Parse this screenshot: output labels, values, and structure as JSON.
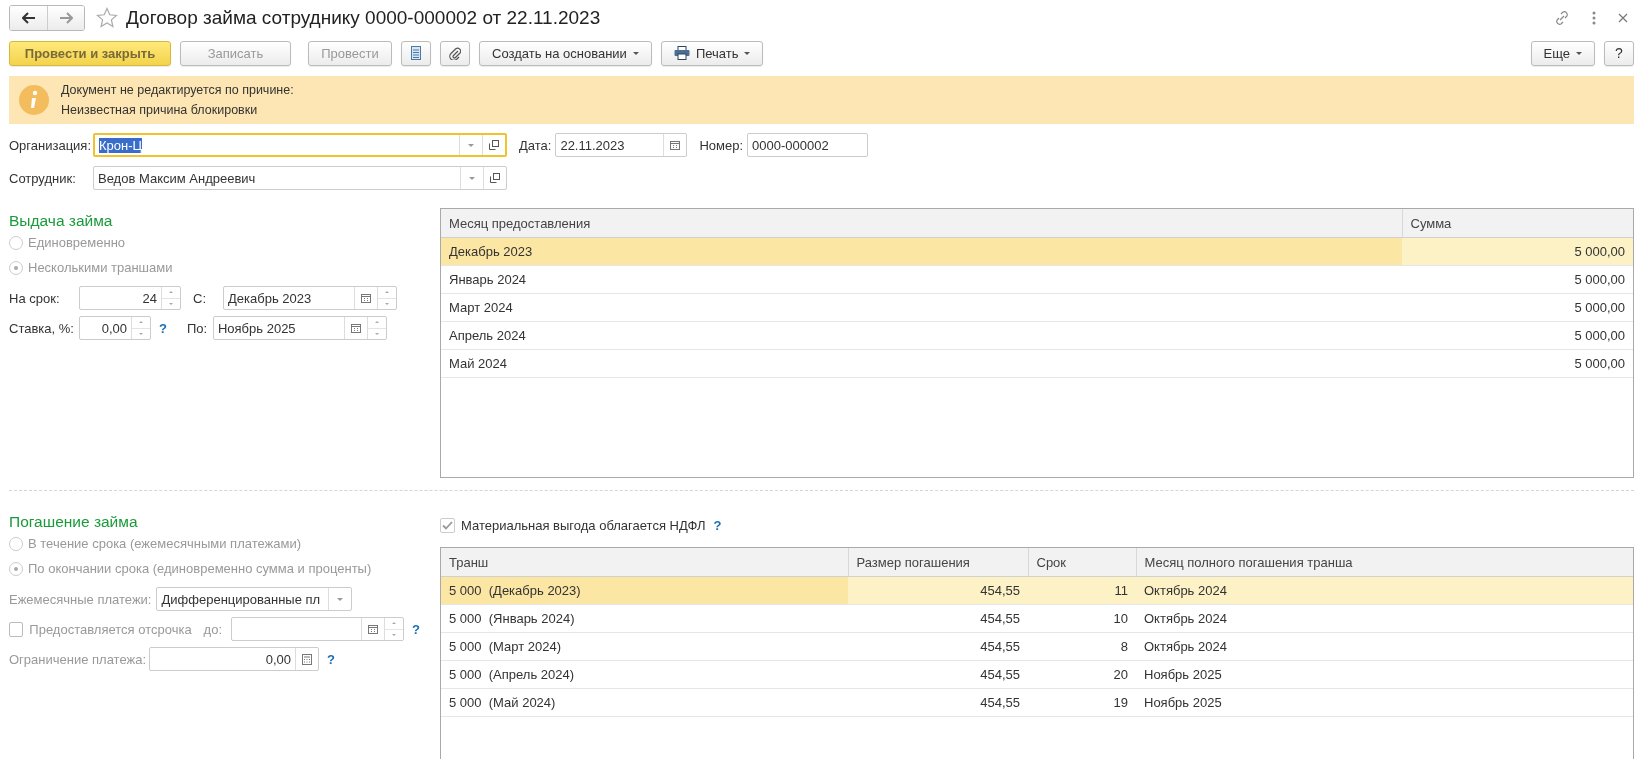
{
  "window": {
    "title": "Договор займа сотруднику 0000-000002 от 22.11.2023"
  },
  "toolbar": {
    "primary": "Провести и закрыть",
    "buttons": [
      {
        "label": "Записать",
        "disabled": true
      },
      {
        "label": "Провести",
        "disabled": true
      }
    ],
    "menus": [
      {
        "label": "Создать на основании",
        "kind": "plain"
      },
      {
        "label": "Печать",
        "kind": "print"
      }
    ],
    "more": "Еще",
    "help": "?"
  },
  "banner": {
    "lines": [
      "Документ не редактируется по причине:",
      "Неизвестная причина блокировки"
    ]
  },
  "organization": {
    "label": "Организация:",
    "value": "Крон-Ц",
    "focused": true
  },
  "date": {
    "label": "Дата:",
    "value": "22.11.2023"
  },
  "number": {
    "label": "Номер:",
    "value": "0000-000002"
  },
  "employee": {
    "label": "Сотрудник:",
    "value": "Ведов Максим Андреевич"
  },
  "issue": {
    "title": "Выдача займа",
    "options": [
      {
        "label": "Единовременно",
        "selected": false
      },
      {
        "label": "Несколькими траншами",
        "selected": true
      }
    ],
    "term": {
      "label": "На срок:",
      "value": "24"
    },
    "from": {
      "label": "С:",
      "value": "Декабрь 2023"
    },
    "rate": {
      "label": "Ставка, %:",
      "value": "0,00",
      "help": "?"
    },
    "to": {
      "label": "По:",
      "value": "Ноябрь 2025"
    },
    "table": {
      "columns": [
        "Месяц предоставления",
        "Сумма"
      ],
      "rows": [
        {
          "cells": [
            "Декабрь 2023",
            "5 000,00"
          ],
          "selected": true
        },
        {
          "cells": [
            "Январь 2024",
            "5 000,00"
          ],
          "selected": false
        },
        {
          "cells": [
            "Март 2024",
            "5 000,00"
          ],
          "selected": false
        },
        {
          "cells": [
            "Апрель 2024",
            "5 000,00"
          ],
          "selected": false
        },
        {
          "cells": [
            "Май 2024",
            "5 000,00"
          ],
          "selected": false
        }
      ]
    }
  },
  "repayment": {
    "title": "Погашение займа",
    "options": [
      {
        "label": "В течение срока (ежемесячными платежами)",
        "selected": false
      },
      {
        "label": "По окончании срока (единовременно сумма и проценты)",
        "selected": true
      }
    ],
    "monthly": {
      "label": "Ежемесячные платежи:",
      "value": "Дифференцированные пл"
    },
    "deferral": {
      "label": "Предоставляется отсрочка",
      "checked": false,
      "until": "до:",
      "help": "?"
    },
    "limit": {
      "label": "Ограничение платежа:",
      "value": "0,00",
      "help": "?"
    },
    "ndfl": {
      "label": "Материальная выгода облагается НДФЛ",
      "checked": true,
      "help": "?"
    },
    "table": {
      "columns": [
        "Транш",
        "Размер погашения",
        "Срок",
        "Месяц полного погашения транша"
      ],
      "rows": [
        {
          "cells": [
            "5 000  (Декабрь 2023)",
            "454,55",
            "11",
            "Октябрь 2024"
          ],
          "selected": true
        },
        {
          "cells": [
            "5 000  (Январь 2024)",
            "454,55",
            "10",
            "Октябрь 2024"
          ],
          "selected": false
        },
        {
          "cells": [
            "5 000  (Март 2024)",
            "454,55",
            "8",
            "Октябрь 2024"
          ],
          "selected": false
        },
        {
          "cells": [
            "5 000  (Апрель 2024)",
            "454,55",
            "20",
            "Ноябрь 2025"
          ],
          "selected": false
        },
        {
          "cells": [
            "5 000  (Май 2024)",
            "454,55",
            "19",
            "Ноябрь 2025"
          ],
          "selected": false
        }
      ]
    }
  }
}
